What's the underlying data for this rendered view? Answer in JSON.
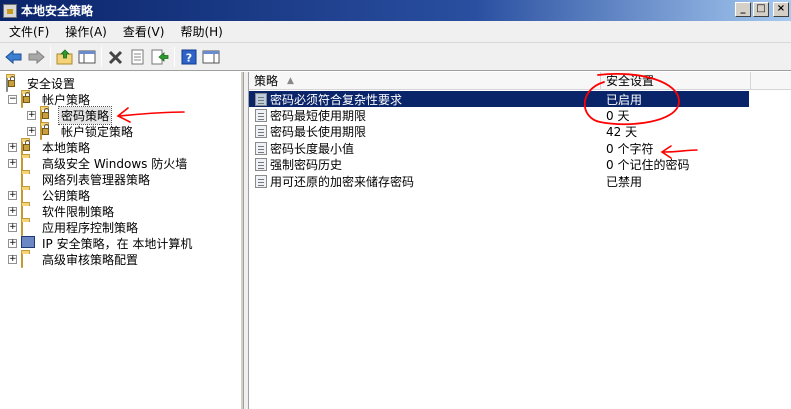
{
  "window": {
    "title": "本地安全策略",
    "controls": [
      "_",
      "□",
      "×"
    ]
  },
  "menu": [
    "文件(F)",
    "操作(A)",
    "查看(V)",
    "帮助(H)"
  ],
  "toolbar": {
    "icons": [
      "back-arrow-icon",
      "forward-arrow-icon",
      "up-folder-icon",
      "show-hide-tree-icon",
      "delete-icon",
      "properties-icon",
      "export-list-icon",
      "help-icon",
      "show-hide-action-pane-icon"
    ]
  },
  "tree": {
    "root": "安全设置",
    "items": [
      {
        "label": "帐户策略",
        "level": 1,
        "expanded": true
      },
      {
        "label": "密码策略",
        "level": 2,
        "selected": true
      },
      {
        "label": "帐户锁定策略",
        "level": 2
      },
      {
        "label": "本地策略",
        "level": 1
      },
      {
        "label": "高级安全 Windows 防火墙",
        "level": 1
      },
      {
        "label": "网络列表管理器策略",
        "level": 1
      },
      {
        "label": "公钥策略",
        "level": 1
      },
      {
        "label": "软件限制策略",
        "level": 1
      },
      {
        "label": "应用程序控制策略",
        "level": 1
      },
      {
        "label": "IP 安全策略，在 本地计算机",
        "level": 1
      },
      {
        "label": "高级审核策略配置",
        "level": 1
      }
    ]
  },
  "list": {
    "columns": {
      "policy": "策略",
      "setting": "安全设置"
    },
    "rows": [
      {
        "policy": "密码必须符合复杂性要求",
        "setting": "已启用",
        "selected": true
      },
      {
        "policy": "密码最短使用期限",
        "setting": "0 天"
      },
      {
        "policy": "密码最长使用期限",
        "setting": "42 天"
      },
      {
        "policy": "密码长度最小值",
        "setting": "0 个字符"
      },
      {
        "policy": "强制密码历史",
        "setting": "0 个记住的密码"
      },
      {
        "policy": "用可还原的加密来储存密码",
        "setting": "已禁用"
      }
    ]
  },
  "colors": {
    "annotation": "#ff0000",
    "selection": "#0a246a"
  }
}
